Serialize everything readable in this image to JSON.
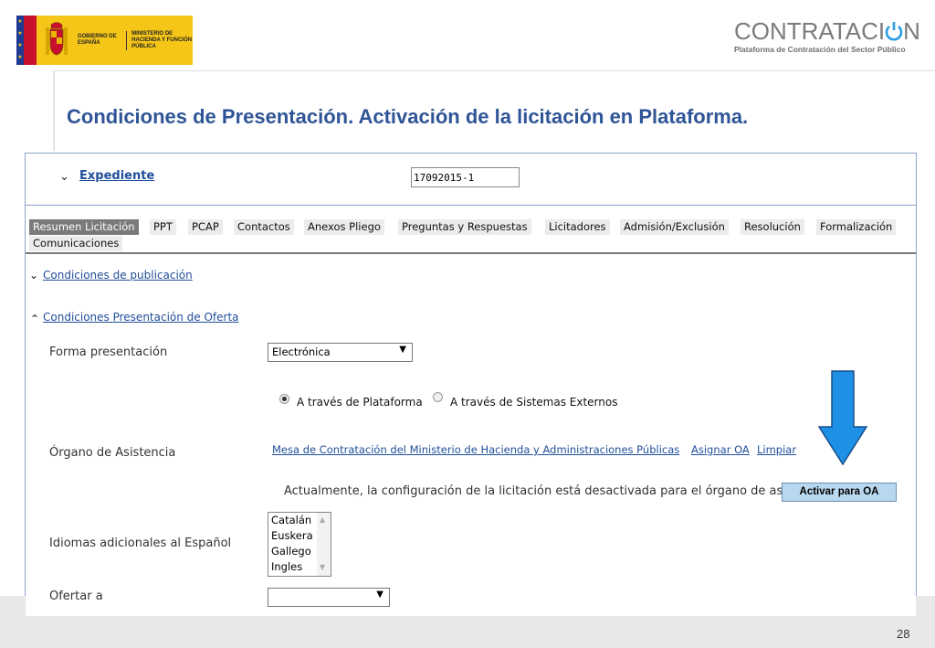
{
  "header": {
    "gov_logo_text_1": "GOBIERNO DE ESPAÑA",
    "gov_logo_text_2": "MINISTERIO DE HACIENDA Y FUNCIÓN PÚBLICA",
    "brand_name_prefix": "CONTRATACI",
    "brand_name_suffix": "N",
    "brand_subtitle": "Plataforma de Contratación del Sector Público",
    "brand_icon": "power-icon",
    "brand_color": "#2b9ce0"
  },
  "slide": {
    "title": "Condiciones de Presentación. Activación de la licitación en Plataforma.",
    "page_number": "28"
  },
  "expediente": {
    "label": "Expediente",
    "value": "17092015-1"
  },
  "tabs": [
    {
      "label": "Resumen Licitación",
      "active": true
    },
    {
      "label": "PPT",
      "active": false
    },
    {
      "label": "PCAP",
      "active": false
    },
    {
      "label": "Contactos",
      "active": false
    },
    {
      "label": "Anexos Pliego",
      "active": false
    },
    {
      "label": "Preguntas y Respuestas",
      "active": false
    },
    {
      "label": "Licitadores",
      "active": false
    },
    {
      "label": "Admisión/Exclusión",
      "active": false
    },
    {
      "label": "Resolución",
      "active": false
    },
    {
      "label": "Formalización",
      "active": false
    },
    {
      "label": "Comunicaciones",
      "active": false
    }
  ],
  "sections": {
    "publicacion": "Condiciones de publicación",
    "presentacion": "Condiciones Presentación de Oferta"
  },
  "form": {
    "forma_presentacion_label": "Forma presentación",
    "forma_presentacion_value": "Electrónica",
    "radio_plataforma": "A través de Plataforma",
    "radio_externos": "A través de Sistemas Externos",
    "radio_selected": "plataforma",
    "organo_label": "Órgano de Asistencia",
    "organo_link": "Mesa de Contratación del Ministerio de Hacienda y Administraciones Públicas",
    "asignar_link": "Asignar OA",
    "limpiar_link": "Limpiar",
    "status_text": "Actualmente, la configuración de la licitación está desactivada para el órgano de asistencia",
    "activar_button": "Activar para OA",
    "idiomas_label": "Idiomas adicionales al Español",
    "idiomas_options": [
      "Catalán",
      "Euskera",
      "Gallego",
      "Ingles"
    ],
    "ofertar_label": "Ofertar a",
    "ofertar_value": ""
  },
  "annotation": {
    "arrow_color": "#1e90e6",
    "arrow_icon": "down-arrow-icon"
  }
}
